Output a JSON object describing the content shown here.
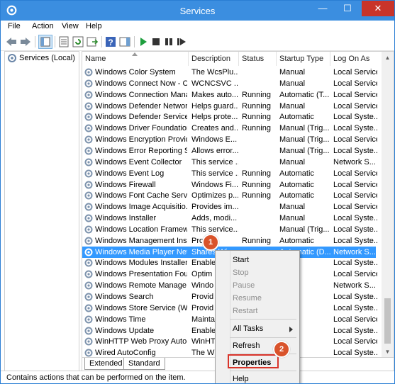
{
  "window": {
    "title": "Services"
  },
  "titlebar_buttons": {
    "minimize": "—",
    "maximize": "☐",
    "close": "✕"
  },
  "menu": [
    "File",
    "Action",
    "View",
    "Help"
  ],
  "tree": {
    "root_label": "Services (Local)"
  },
  "columns": [
    "Name",
    "Description",
    "Status",
    "Startup Type",
    "Log On As"
  ],
  "rows": [
    {
      "name": "Windows Color System",
      "description": "The WcsPlu...",
      "status": "",
      "startup": "Manual",
      "logon": "Local Service"
    },
    {
      "name": "Windows Connect Now - C...",
      "description": "WCNCSVC ...",
      "status": "",
      "startup": "Manual",
      "logon": "Local Service"
    },
    {
      "name": "Windows Connection Mana...",
      "description": "Makes auto...",
      "status": "Running",
      "startup": "Automatic (T...",
      "logon": "Local Service"
    },
    {
      "name": "Windows Defender Networ...",
      "description": "Helps guard...",
      "status": "Running",
      "startup": "Manual",
      "logon": "Local Service"
    },
    {
      "name": "Windows Defender Service",
      "description": "Helps prote...",
      "status": "Running",
      "startup": "Automatic",
      "logon": "Local Syste..."
    },
    {
      "name": "Windows Driver Foundation...",
      "description": "Creates and...",
      "status": "Running",
      "startup": "Manual (Trig...",
      "logon": "Local Syste..."
    },
    {
      "name": "Windows Encryption Provid...",
      "description": "Windows E...",
      "status": "",
      "startup": "Manual (Trig...",
      "logon": "Local Service"
    },
    {
      "name": "Windows Error Reporting Se...",
      "description": "Allows error...",
      "status": "",
      "startup": "Manual (Trig...",
      "logon": "Local Syste..."
    },
    {
      "name": "Windows Event Collector",
      "description": "This service ...",
      "status": "",
      "startup": "Manual",
      "logon": "Network S..."
    },
    {
      "name": "Windows Event Log",
      "description": "This service ...",
      "status": "Running",
      "startup": "Automatic",
      "logon": "Local Service"
    },
    {
      "name": "Windows Firewall",
      "description": "Windows Fi...",
      "status": "Running",
      "startup": "Automatic",
      "logon": "Local Service"
    },
    {
      "name": "Windows Font Cache Service",
      "description": "Optimizes p...",
      "status": "Running",
      "startup": "Automatic",
      "logon": "Local Service"
    },
    {
      "name": "Windows Image Acquisitio...",
      "description": "Provides im...",
      "status": "",
      "startup": "Manual",
      "logon": "Local Service"
    },
    {
      "name": "Windows Installer",
      "description": "Adds, modi...",
      "status": "",
      "startup": "Manual",
      "logon": "Local Syste..."
    },
    {
      "name": "Windows Location Framew...",
      "description": "This service...",
      "status": "",
      "startup": "Manual (Trig...",
      "logon": "Local Syste..."
    },
    {
      "name": "Windows Management Inst...",
      "description": "Pro...",
      "status": "Running",
      "startup": "Automatic",
      "logon": "Local Syste..."
    },
    {
      "name": "Windows Media Player Net...",
      "description": "Shares Win...",
      "status": "",
      "startup": "Automatic (D...",
      "logon": "Network S..."
    },
    {
      "name": "Windows Modules Installer",
      "description": "Enable",
      "status": "",
      "startup": "",
      "logon": "Local Syste..."
    },
    {
      "name": "Windows Presentation Fou...",
      "description": "Optim",
      "status": "",
      "startup": "",
      "logon": "Local Service"
    },
    {
      "name": "Windows Remote Manage...",
      "description": "Windo",
      "status": "",
      "startup": "",
      "logon": "Network S..."
    },
    {
      "name": "Windows Search",
      "description": "Provid",
      "status": "",
      "startup": "",
      "logon": "Local Syste..."
    },
    {
      "name": "Windows Store Service (WS...",
      "description": "Provid",
      "status": "",
      "startup": "",
      "logon": "Local Syste..."
    },
    {
      "name": "Windows Time",
      "description": "Mainta",
      "status": "",
      "startup": "",
      "logon": "Local Service"
    },
    {
      "name": "Windows Update",
      "description": "Enable",
      "status": "",
      "startup": "",
      "logon": "Local Syste..."
    },
    {
      "name": "WinHTTP Web Proxy Auto-...",
      "description": "WinHT",
      "status": "",
      "startup": "",
      "logon": "Local Service"
    },
    {
      "name": "Wired AutoConfig",
      "description": "The W",
      "status": "",
      "startup": "",
      "logon": "Local Syste..."
    }
  ],
  "selected_row_index": 16,
  "tabs": [
    "Extended",
    "Standard"
  ],
  "status_text": "Contains actions that can be performed on the item.",
  "context_menu": {
    "start": "Start",
    "stop": "Stop",
    "pause": "Pause",
    "resume": "Resume",
    "restart": "Restart",
    "all_tasks": "All Tasks",
    "refresh": "Refresh",
    "properties": "Properties",
    "help": "Help"
  },
  "callouts": [
    "1",
    "2"
  ],
  "colors": {
    "title_bar": "#3b8ee0",
    "selection": "#3399ff",
    "callout": "#d9532b",
    "highlight": "#d9342a"
  }
}
